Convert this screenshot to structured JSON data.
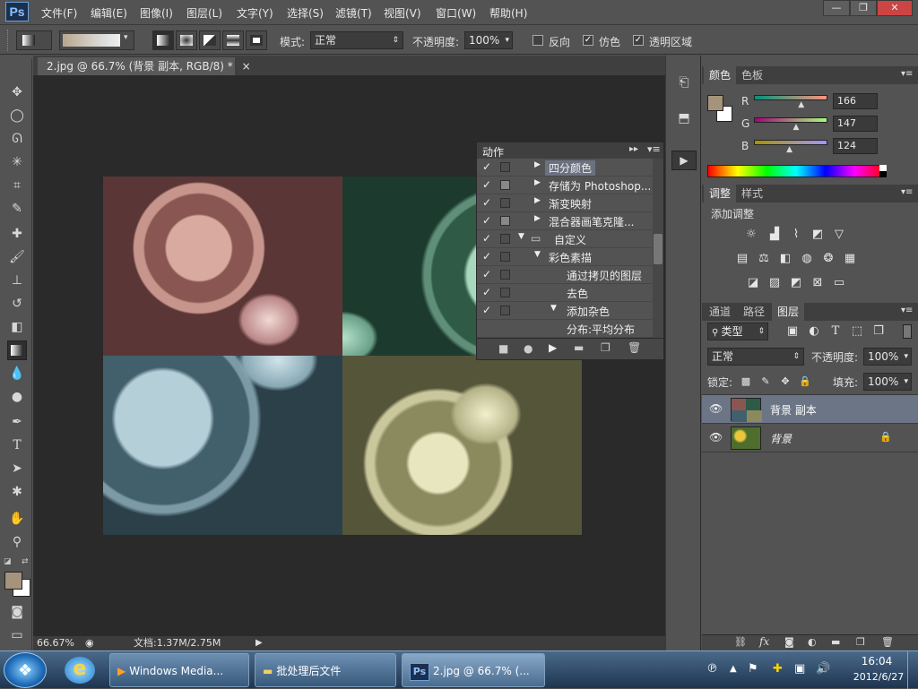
{
  "app": {
    "logo": "Ps"
  },
  "menu": [
    "文件(F)",
    "编辑(E)",
    "图像(I)",
    "图层(L)",
    "文字(Y)",
    "选择(S)",
    "滤镜(T)",
    "视图(V)",
    "窗口(W)",
    "帮助(H)"
  ],
  "window_controls": {
    "minimize": "—",
    "restore": "❐",
    "close": "✕"
  },
  "options": {
    "mode_label": "模式:",
    "mode_value": "正常",
    "opacity_label": "不透明度:",
    "opacity_value": "100%",
    "reverse_label": "反向",
    "dither_label": "仿色",
    "transparency_label": "透明区域",
    "reverse_checked": false,
    "dither_checked": true,
    "transparency_checked": true
  },
  "document": {
    "tab_title": "2.jpg @ 66.7% (背景 副本, RGB/8) *",
    "tab_close": "×",
    "zoom": "66.67%",
    "doc_info": "文档:1.37M/2.75M"
  },
  "actions_panel": {
    "title": "动作",
    "rows": [
      {
        "label": "四分颜色",
        "checked": true,
        "dialog": false,
        "expand": "▶",
        "indent": 1,
        "highlight": true
      },
      {
        "label": "存储为 Photoshop...",
        "checked": true,
        "dialog": true,
        "expand": "▶",
        "indent": 1,
        "highlight": false
      },
      {
        "label": "渐变映射",
        "checked": true,
        "dialog": false,
        "expand": "▶",
        "indent": 1,
        "highlight": false
      },
      {
        "label": "混合器画笔克隆...",
        "checked": true,
        "dialog": true,
        "expand": "▶",
        "indent": 1,
        "highlight": false
      },
      {
        "label": "自定义",
        "checked": true,
        "dialog": false,
        "expand": "▼",
        "indent": 0,
        "folder": true,
        "highlight": false
      },
      {
        "label": "彩色素描",
        "checked": true,
        "dialog": false,
        "expand": "▼",
        "indent": 1,
        "highlight": false
      },
      {
        "label": "通过拷贝的图层",
        "checked": true,
        "dialog": false,
        "expand": "",
        "indent": 2,
        "highlight": false
      },
      {
        "label": "去色",
        "checked": true,
        "dialog": false,
        "expand": "",
        "indent": 2,
        "highlight": false
      },
      {
        "label": "添加杂色",
        "checked": true,
        "dialog": false,
        "expand": "▼",
        "indent": 2,
        "highlight": false
      },
      {
        "label": "分布:平均分布",
        "checked": false,
        "dialog": false,
        "expand": "",
        "indent": 3,
        "highlight": false
      }
    ]
  },
  "color_panel": {
    "tabs": [
      "颜色",
      "色板"
    ],
    "r_label": "R",
    "g_label": "G",
    "b_label": "B",
    "r": "166",
    "g": "147",
    "b": "124",
    "r_frac": 0.65,
    "g_frac": 0.58,
    "b_frac": 0.49,
    "fg_color": "#a6937c",
    "bg_color": "#ffffff"
  },
  "adjust_panel": {
    "tabs": [
      "调整",
      "样式"
    ],
    "title": "添加调整"
  },
  "layers_panel": {
    "tabs": [
      "通道",
      "路径",
      "图层"
    ],
    "filter_label": "类型",
    "blend_mode": "正常",
    "opacity_label": "不透明度:",
    "opacity_value": "100%",
    "lock_label": "锁定:",
    "fill_label": "填充:",
    "fill_value": "100%",
    "layers": [
      {
        "name": "背景 副本",
        "selected": true,
        "locked": false
      },
      {
        "name": "背景",
        "selected": false,
        "locked": true
      }
    ]
  },
  "taskbar": {
    "items": [
      "Windows Media...",
      "批处理后文件",
      "2.jpg @ 66.7% (..."
    ],
    "time": "16:04",
    "date": "2012/6/27"
  }
}
